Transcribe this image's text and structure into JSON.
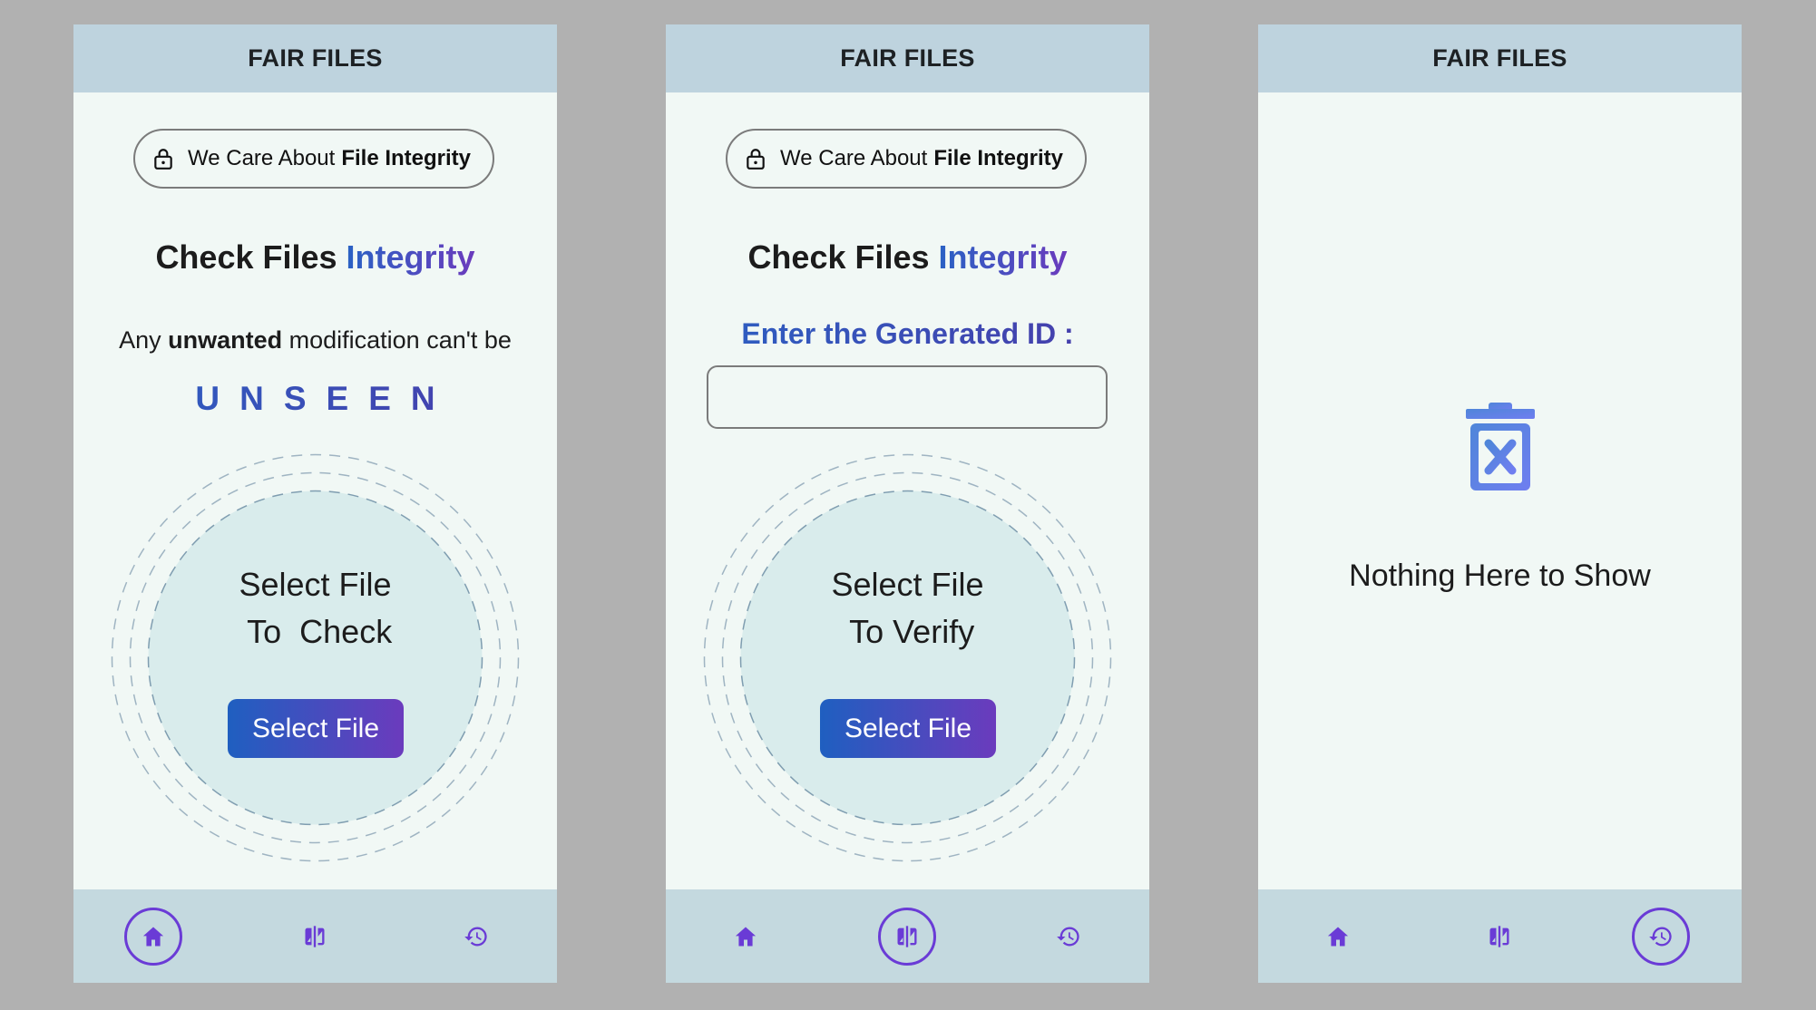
{
  "app_title": "FAIR FILES",
  "pill": {
    "prefix": "We Care About",
    "emphasis": "File Integrity"
  },
  "heading": {
    "text": "Check Files",
    "accent": "Integrity"
  },
  "colors": {
    "accent_blue": "#2a62c4",
    "accent_purple": "#6b3bbd",
    "appbar": "#bed3de",
    "navbar": "#c4d9df",
    "screen_bg": "#f1f8f5"
  },
  "screens": [
    {
      "tagline": {
        "pre": "Any",
        "bold": "unwanted",
        "post": "modification can't be"
      },
      "highlight": "UNSEEN",
      "drop_text": "Select File\n To  Check",
      "button_label": "Select File",
      "active_tab": "home"
    },
    {
      "input_label": "Enter the Generated ID :",
      "input_value": "",
      "drop_text": "Select File\n To Verify",
      "button_label": "Select File",
      "active_tab": "verify"
    },
    {
      "empty_icon": "trash-x-icon",
      "empty_text": "Nothing Here to Show",
      "active_tab": "history"
    }
  ],
  "nav_icons": {
    "home": "home-icon",
    "verify": "compare-icon",
    "history": "history-icon"
  }
}
